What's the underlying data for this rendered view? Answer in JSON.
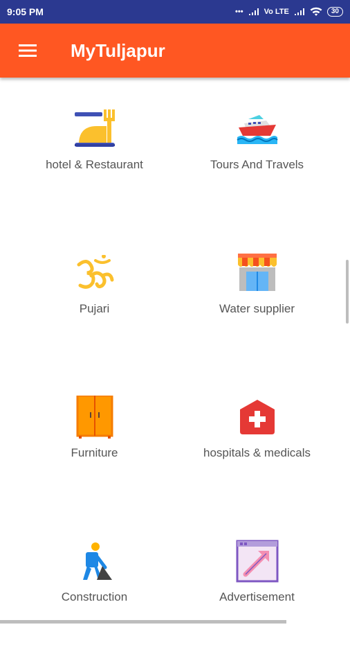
{
  "status": {
    "time": "9:05 PM",
    "network": "Vo LTE",
    "battery": "30"
  },
  "app": {
    "title": "MyTuljapur"
  },
  "categories": [
    {
      "label": "hotel & Restaurant",
      "icon": "hotel-restaurant-icon"
    },
    {
      "label": "Tours And Travels",
      "icon": "ship-icon"
    },
    {
      "label": "Pujari",
      "icon": "om-icon"
    },
    {
      "label": "Water supplier",
      "icon": "shop-icon"
    },
    {
      "label": "Furniture",
      "icon": "cupboard-icon"
    },
    {
      "label": "hospitals & medicals",
      "icon": "hospital-icon"
    },
    {
      "label": "Construction",
      "icon": "construction-worker-icon"
    },
    {
      "label": "Advertisement",
      "icon": "advertisement-icon"
    }
  ],
  "colors": {
    "status_bar": "#2b3990",
    "app_bar": "#ff5722",
    "label_text": "#555555"
  }
}
